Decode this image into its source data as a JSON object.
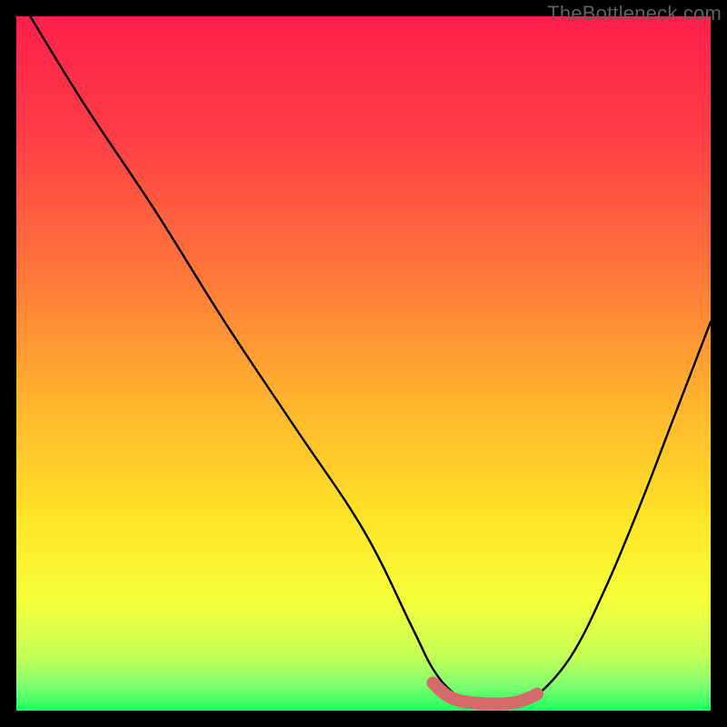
{
  "watermark": "TheBottleneck.com",
  "chart_data": {
    "type": "line",
    "title": "",
    "xlabel": "",
    "ylabel": "",
    "xlim": [
      0,
      100
    ],
    "ylim": [
      0,
      100
    ],
    "grid": false,
    "legend": false,
    "annotations": [],
    "series": [
      {
        "name": "curve",
        "color": "#000000",
        "x": [
          2,
          10,
          20,
          30,
          40,
          50,
          57,
          60,
          63,
          66,
          69,
          72,
          75,
          80,
          85,
          90,
          95,
          100
        ],
        "y": [
          100,
          87,
          72,
          56,
          41,
          26,
          12,
          6,
          2.5,
          1.2,
          0.9,
          1.1,
          2.2,
          8,
          18,
          30,
          43,
          56
        ]
      },
      {
        "name": "highlight",
        "color": "#d46a6a",
        "x": [
          60,
          62,
          64,
          66,
          68,
          70,
          72,
          74,
          75
        ],
        "y": [
          4.0,
          2.2,
          1.4,
          1.1,
          1.0,
          1.0,
          1.2,
          1.9,
          2.4
        ]
      }
    ],
    "gradient_stops": [
      {
        "offset": 0.0,
        "color": "#ff1f4b"
      },
      {
        "offset": 0.18,
        "color": "#ff3f46"
      },
      {
        "offset": 0.38,
        "color": "#ff7a3a"
      },
      {
        "offset": 0.55,
        "color": "#ffb22e"
      },
      {
        "offset": 0.72,
        "color": "#ffe327"
      },
      {
        "offset": 0.84,
        "color": "#f6ff3a"
      },
      {
        "offset": 0.92,
        "color": "#c6ff55"
      },
      {
        "offset": 0.965,
        "color": "#7dff70"
      },
      {
        "offset": 1.0,
        "color": "#1eff5e"
      }
    ]
  }
}
